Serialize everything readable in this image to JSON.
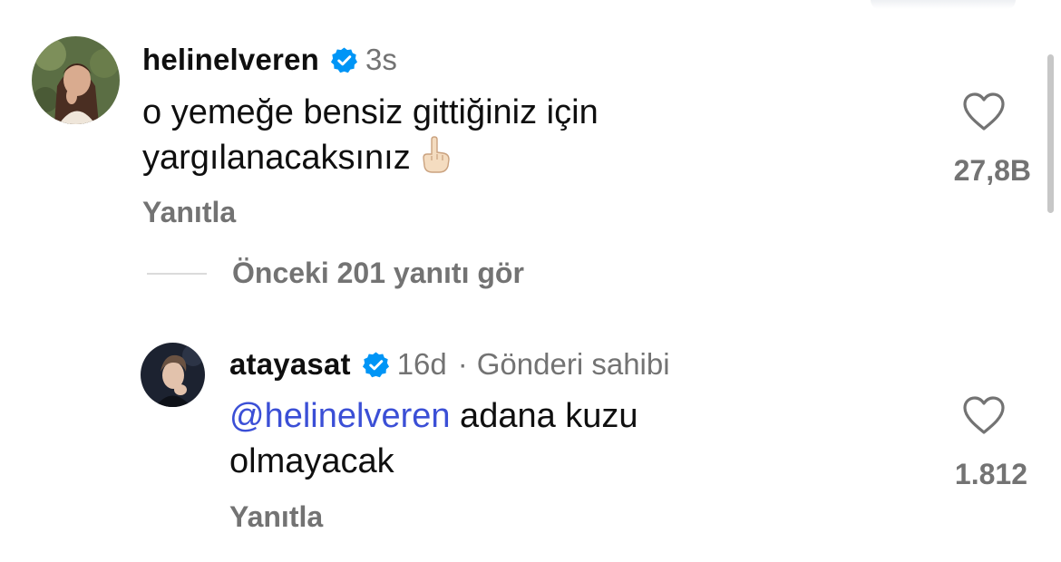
{
  "comments": [
    {
      "username": "helinelveren",
      "verified": true,
      "time": "3s",
      "text_line1": "o yemeğe bensiz gittiğiniz için",
      "text_line2": "yargılanacaksınız",
      "emoji": "pointing-up-hand",
      "reply_label": "Yanıtla",
      "like_count": "27,8B",
      "liked": false
    },
    {
      "username": "atayasat",
      "verified": true,
      "time": "16d",
      "separator": "·",
      "author_label": "Gönderi sahibi",
      "mention": "@helinelveren",
      "text_after_mention": " adana kuzu",
      "text_line2": "olmayacak",
      "reply_label": "Yanıtla",
      "like_count": "1.812",
      "liked": false
    }
  ],
  "view_replies_label": "Önceki 201 yanıtı gör",
  "colors": {
    "text": "#0f0f0f",
    "secondary": "#737373",
    "mention": "#3b4fd6",
    "verified_badge": "#0095f6"
  },
  "icons": {
    "like": "heart-outline-icon",
    "verified": "verified-badge-icon"
  }
}
